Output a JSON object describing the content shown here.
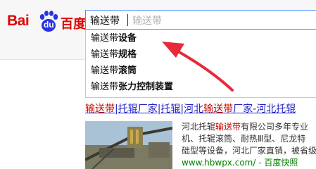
{
  "logo": {
    "bai": "Bai",
    "du": "du",
    "chinese": "百度"
  },
  "search": {
    "value": "输送带",
    "placeholder": "输送带"
  },
  "suggestions": [
    {
      "prefix": "输送带",
      "rest": "设备"
    },
    {
      "prefix": "输送带",
      "rest": "规格"
    },
    {
      "prefix": "输送带",
      "rest": "滚筒"
    },
    {
      "prefix": "输送带",
      "rest": "张力控制装置"
    }
  ],
  "result": {
    "title_kw1": "输送带",
    "title_mid": "|托辊厂家|托辊|河北",
    "title_kw2": "输送带",
    "title_end": "厂家-河北托辊",
    "line1_a": "河北托辊",
    "line1_kw": "输送带",
    "line1_b": "有限公司多年专业",
    "line2": "机、托辊滚筒、耐热Ⅲ型、尼龙特",
    "line3": "础型等设备，河北厂家直销，被省级",
    "url": "www.hbwpx.com/  -  百度快照"
  },
  "colors": {
    "accent": "#4791ff",
    "brand": "#e10601",
    "link": "#2323c8",
    "keyword": "#c60a00",
    "url": "#008000",
    "arrow": "#e8293a"
  }
}
